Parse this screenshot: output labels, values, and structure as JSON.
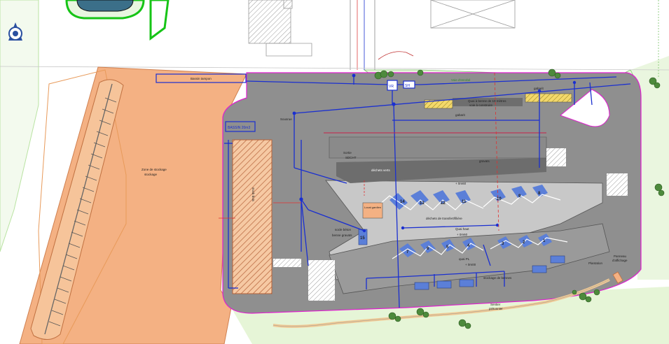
{
  "labels": {
    "bassin_tampon": "Bassin tampon",
    "zone_stockage": "Zone de stockage",
    "zone_stockage_2": "stockage",
    "bassin_vol": "BASSIN 20m3",
    "sortie_rue": "Sousrue",
    "stock_bois": "stock bois",
    "dechets_verts": "déchets verts",
    "gravats": "gravats",
    "quai_beton": "Quai à benne de 10 mètres",
    "quai_beton_2": "voie à construire",
    "voie_enrobe": "Voie d'enrobé",
    "gabarit_1": "gabarit",
    "gabarit_2": "gabarit",
    "local_gardien": "Local gardien",
    "dechets_menagers": "déchets de transfert/filière",
    "quai_haut": "Quai haut",
    "quai_haut_2": "+ 0m60",
    "quai_bas": "quai PL",
    "quai_bas_2": "+ 0m00",
    "cote_1": "+ 0m60",
    "socle_beton": "socle béton",
    "benne_gravats": "benne gravats",
    "stockage_bennes": "stockage de bennes",
    "sentier": "Sentier",
    "sentier_2": "piétonnier",
    "panneau": "Panneau",
    "panneau_2": "d'affichage",
    "plantation": "Plantation",
    "vr": "VR",
    "sh": "SH",
    "sdcht": "Sortie",
    "parking": "SDCHT"
  },
  "bays_upper": [
    "14",
    "13",
    "12",
    "11",
    "10",
    "9",
    "8"
  ],
  "bays_lower": [
    "7",
    "6",
    "5",
    "4",
    "3",
    "2",
    "1"
  ],
  "bay_left": "15",
  "colors": {
    "tarmac": "#8f8f8f",
    "tarmac_light": "#cfcfcf",
    "storage": "#f4b183",
    "grass": "#e3f4d5",
    "network": "#1a2fd0",
    "bay": "#5b7fd8",
    "hatch_orange": "#d98a4e",
    "yellow": "#e9c84a",
    "tree": "#4d8a3c",
    "magenta": "#e01fd0"
  }
}
